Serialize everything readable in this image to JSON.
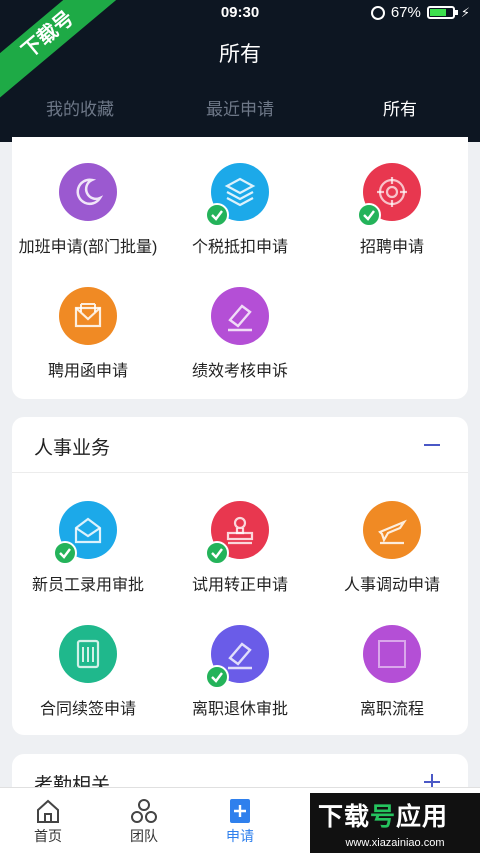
{
  "status_bar": {
    "time": "09:30",
    "battery": "67%"
  },
  "header": {
    "title": "所有",
    "tabs": [
      {
        "label": "我的收藏"
      },
      {
        "label": "最近申请"
      },
      {
        "label": "所有"
      }
    ]
  },
  "watermark": {
    "ribbon": "下载号",
    "brand_prefix": "下载",
    "brand_highlight": "号",
    "brand_suffix": "应用",
    "url": "www.xiazainiao.com"
  },
  "section1": {
    "items": [
      {
        "label": "加班申请(部门批量)",
        "icon": "moon-icon",
        "color": "#9b59d0",
        "checked": false
      },
      {
        "label": "个税抵扣申请",
        "icon": "layers-icon",
        "color": "#1ca9e9",
        "checked": true
      },
      {
        "label": "招聘申请",
        "icon": "target-icon",
        "color": "#e8374f",
        "checked": true
      },
      {
        "label": "聘用函申请",
        "icon": "envelope-icon",
        "color": "#f08a24",
        "checked": false
      },
      {
        "label": "绩效考核申诉",
        "icon": "gavel-icon",
        "color": "#b44fd6",
        "checked": false
      }
    ]
  },
  "section2": {
    "title": "人事业务",
    "items": [
      {
        "label": "新员工录用审批",
        "icon": "mail-open-icon",
        "color": "#1ca9e9",
        "checked": true
      },
      {
        "label": "试用转正申请",
        "icon": "stamp-icon",
        "color": "#e8374f",
        "checked": true
      },
      {
        "label": "人事调动申请",
        "icon": "plane-icon",
        "color": "#f08a24",
        "checked": false
      },
      {
        "label": "合同续签申请",
        "icon": "contract-icon",
        "color": "#1fb88c",
        "checked": false
      },
      {
        "label": "离职退休审批",
        "icon": "gavel-icon",
        "color": "#6a5ce8",
        "checked": true
      },
      {
        "label": "离职流程",
        "icon": "square-icon",
        "color": "#b44fd6",
        "checked": false
      }
    ]
  },
  "section3": {
    "title": "考勤相关"
  },
  "bottom_nav": [
    {
      "label": "首页",
      "icon": "home-icon"
    },
    {
      "label": "团队",
      "icon": "team-icon"
    },
    {
      "label": "申请",
      "icon": "apply-icon"
    }
  ],
  "colors": {
    "header_bg": "#0d1622",
    "accent": "#2f80ed",
    "check_green": "#24b35a"
  }
}
